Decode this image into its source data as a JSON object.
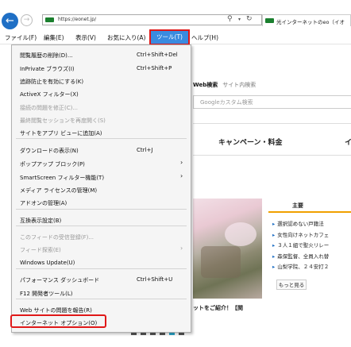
{
  "address_bar": {
    "url": "https://eonet.jp/",
    "search_icon": "⚲",
    "dropdown_icon": "▾",
    "refresh_icon": "↻"
  },
  "tab": {
    "title": "光インターネットのeo（イオ"
  },
  "menu": {
    "file": "ファイル(F)",
    "edit": "編集(E)",
    "view": "表示(V)",
    "favorites": "お気に入り(A)",
    "tools": "ツール(T)",
    "help": "ヘルプ(H)"
  },
  "tools_menu": [
    {
      "label": "閲覧履歴の削除(D)...",
      "shortcut": "Ctrl+Shift+Del",
      "disabled": false
    },
    {
      "label": "InPrivate ブラウズ(I)",
      "shortcut": "Ctrl+Shift+P",
      "disabled": false
    },
    {
      "label": "追跡防止を有効にする(K)",
      "shortcut": "",
      "disabled": false
    },
    {
      "label": "ActiveX フィルター(X)",
      "shortcut": "",
      "disabled": false
    },
    {
      "label": "接続の問題を修正(C)...",
      "shortcut": "",
      "disabled": true
    },
    {
      "label": "最終閲覧セッションを再度開く(S)",
      "shortcut": "",
      "disabled": true
    },
    {
      "label": "サイトをアプリ ビューに追加(A)",
      "shortcut": "",
      "disabled": false
    },
    {
      "label": "ダウンロードの表示(N)",
      "shortcut": "Ctrl+J",
      "disabled": false
    },
    {
      "label": "ポップアップ ブロック(P)",
      "shortcut": "",
      "disabled": false,
      "submenu": true
    },
    {
      "label": "SmartScreen フィルター機能(T)",
      "shortcut": "",
      "disabled": false,
      "submenu": true
    },
    {
      "label": "メディア ライセンスの管理(M)",
      "shortcut": "",
      "disabled": false
    },
    {
      "label": "アドオンの管理(A)",
      "shortcut": "",
      "disabled": false
    },
    {
      "label": "互換表示設定(B)",
      "shortcut": "",
      "disabled": false
    },
    {
      "label": "このフィードの受信登録(F)...",
      "shortcut": "",
      "disabled": true
    },
    {
      "label": "フィード探索(E)",
      "shortcut": "",
      "disabled": true,
      "submenu": true
    },
    {
      "label": "Windows Update(U)",
      "shortcut": "",
      "disabled": false
    },
    {
      "label": "パフォーマンス ダッシュボード",
      "shortcut": "Ctrl+Shift+U",
      "disabled": false
    },
    {
      "label": "F12 開発者ツール(L)",
      "shortcut": "",
      "disabled": false
    },
    {
      "label": "Web サイトの問題を報告(R)",
      "shortcut": "",
      "disabled": false
    },
    {
      "label": "インターネット オプション(O)",
      "shortcut": "",
      "disabled": false
    }
  ],
  "page": {
    "search_tab_web": "Web検索",
    "search_tab_site": "サイト内検索",
    "search_placeholder": "Googleカスタム検索",
    "campaign": "キャンペーン・料金",
    "campaign_cut": "イ",
    "caption": "ットをご紹介！【関",
    "news_tab": "主要",
    "news": [
      "選択認めない戸籍法",
      "女性向けネットカフェ",
      "３人１組で聖火リレー",
      "森保監督、全員入れ替",
      "山梨学院、２４安打２"
    ],
    "more": "もっと見る"
  }
}
